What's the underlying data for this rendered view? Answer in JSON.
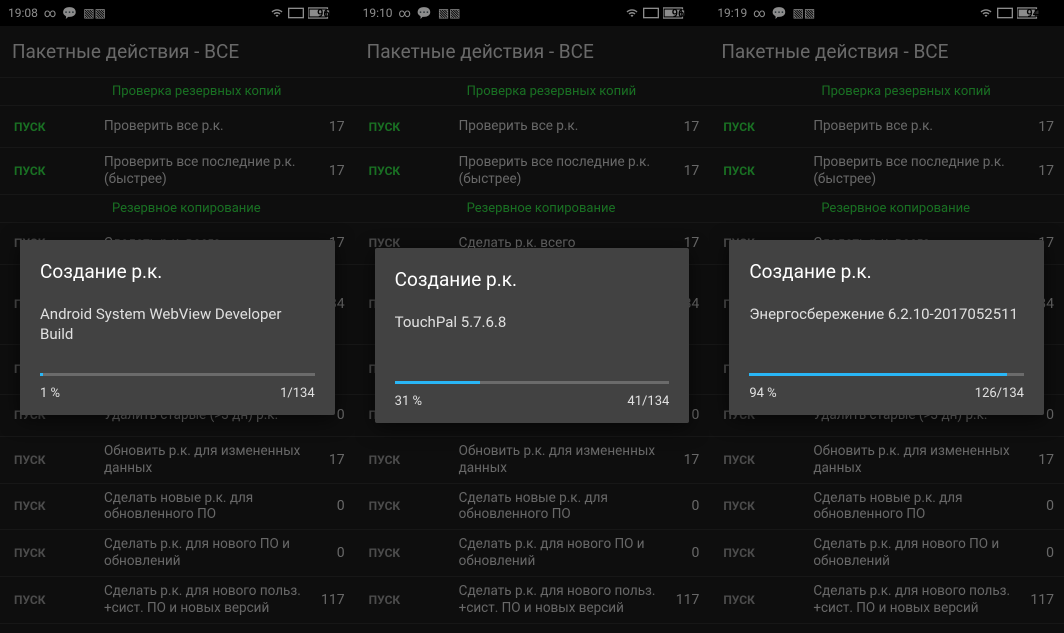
{
  "screens": [
    {
      "status": {
        "time": "19:08",
        "battery": "96"
      },
      "title": "Пакетные действия - ВСЕ",
      "dialog": {
        "title": "Создание р.к.",
        "message": "Android System WebView Developer Build",
        "percent_label": "1 %",
        "percent": 1,
        "count": "1/134"
      }
    },
    {
      "status": {
        "time": "19:10",
        "battery": "96"
      },
      "title": "Пакетные действия - ВСЕ",
      "dialog": {
        "title": "Создание р.к.",
        "message": "TouchPal 5.7.6.8",
        "percent_label": "31 %",
        "percent": 31,
        "count": "41/134"
      }
    },
    {
      "status": {
        "time": "19:19",
        "battery": "94"
      },
      "title": "Пакетные действия - ВСЕ",
      "dialog": {
        "title": "Создание р.к.",
        "message": "Энергосбережение 6.2.10-2017052511",
        "percent_label": "94 %",
        "percent": 94,
        "count": "126/134"
      }
    }
  ],
  "sections": {
    "verify_header": "Проверка резервных копий",
    "backup_header": "Резервное копирование"
  },
  "run_label": "ПУСК",
  "rows_top": [
    {
      "label": "Проверить все р.к.",
      "count": "17"
    },
    {
      "label": "Проверить все последние р.к. (быстрее)",
      "count": "17"
    }
  ],
  "rows_mid": [
    {
      "label": "Сделать р.к. всего",
      "count": "17"
    },
    {
      "label": "",
      "count": "34"
    }
  ],
  "rows_bottom": [
    {
      "label": "Удалить старые (>3 дн) р.к.",
      "count": "0"
    },
    {
      "label": "Обновить р.к. для измененных данных",
      "count": "17"
    },
    {
      "label": "Сделать новые р.к. для обновленного ПО",
      "count": "0"
    },
    {
      "label": "Сделать р.к. для нового ПО и обновлений",
      "count": "0"
    },
    {
      "label": "Сделать р.к. для нового польз. +сист. ПО и новых версий",
      "count": "117"
    }
  ]
}
